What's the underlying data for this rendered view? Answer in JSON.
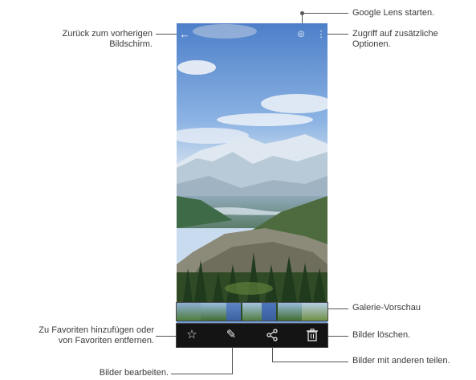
{
  "annotations": {
    "back": "Zurück zum vorherigen\nBildschirm.",
    "back_line1": "Zurück zum vorherigen",
    "back_line2": "Bildschirm.",
    "lens": "Google Lens starten.",
    "options_line1": "Zugriff auf zusätzliche",
    "options_line2": "Optionen.",
    "preview": "Galerie-Vorschau",
    "favorites_line1": "Zu Favoriten hinzufügen oder",
    "favorites_line2": "von Favoriten entfernen.",
    "delete": "Bilder löschen.",
    "share": "Bilder mit anderen teilen.",
    "edit": "Bilder bearbeiten."
  },
  "icons": {
    "back": "arrow-left-icon",
    "lens": "google-lens-icon",
    "more": "more-vertical-icon",
    "favorite": "star-icon",
    "edit": "pencil-icon",
    "share": "share-icon",
    "delete": "trash-icon"
  },
  "colors": {
    "toolbar_bg": "#141414",
    "sky": "#6f9bd6",
    "callout": "#4a4a4a"
  }
}
